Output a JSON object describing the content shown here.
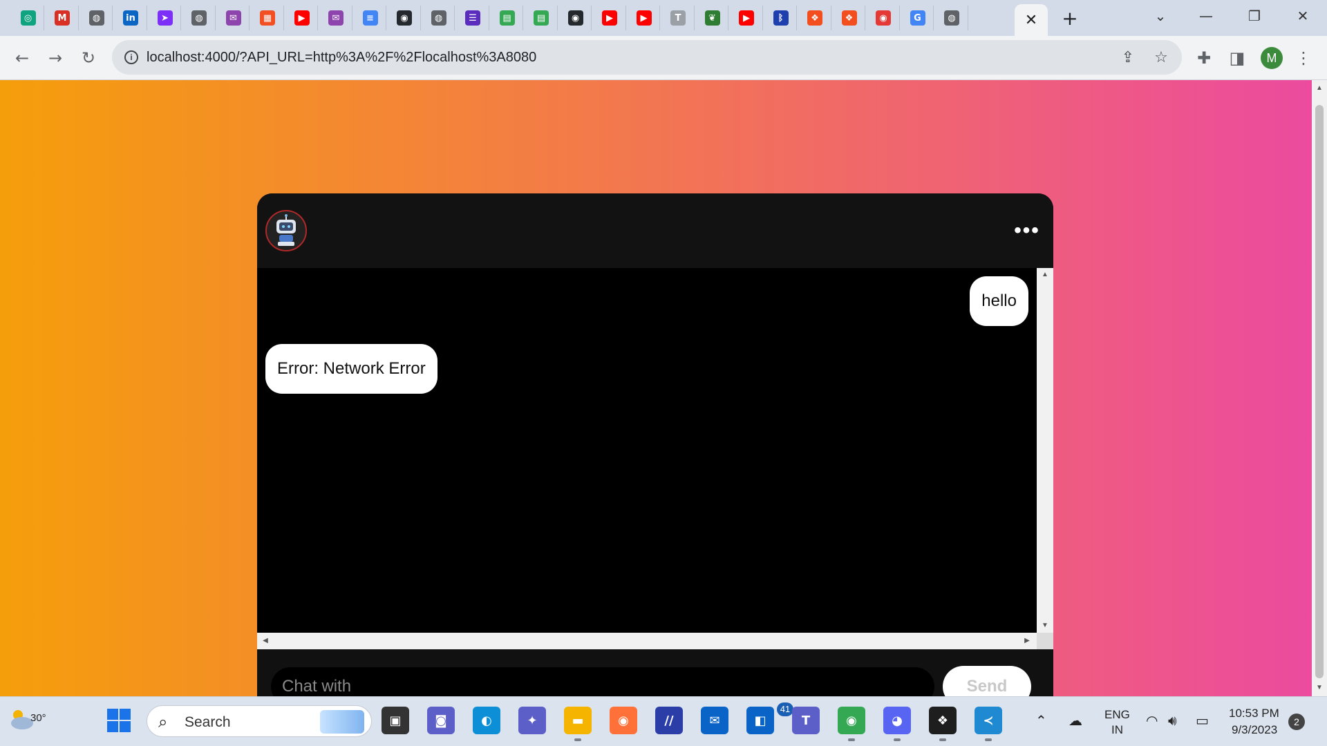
{
  "browser": {
    "tabs": [
      {
        "icon": "chatgpt-icon",
        "glyph": "◎",
        "color": "#10a37f"
      },
      {
        "icon": "gmail-icon",
        "glyph": "M",
        "color": "#d93025"
      },
      {
        "icon": "globe-icon",
        "glyph": "◍",
        "color": "#5f6368"
      },
      {
        "icon": "linkedin-icon",
        "glyph": "in",
        "color": "#0a66c2"
      },
      {
        "icon": "arrow-app-icon",
        "glyph": "➤",
        "color": "#7b2ff7"
      },
      {
        "icon": "globe-icon",
        "glyph": "◍",
        "color": "#5f6368"
      },
      {
        "icon": "mail-icon",
        "glyph": "✉",
        "color": "#8e44ad"
      },
      {
        "icon": "microsoft-icon",
        "glyph": "▦",
        "color": "#f25022"
      },
      {
        "icon": "youtube-icon",
        "glyph": "▶",
        "color": "#ff0000"
      },
      {
        "icon": "mail-icon",
        "glyph": "✉",
        "color": "#8e44ad"
      },
      {
        "icon": "docs-icon",
        "glyph": "≡",
        "color": "#4285f4"
      },
      {
        "icon": "github-icon",
        "glyph": "◉",
        "color": "#24292e"
      },
      {
        "icon": "globe-icon",
        "glyph": "◍",
        "color": "#5f6368"
      },
      {
        "icon": "list-app-icon",
        "glyph": "☰",
        "color": "#5b2dbf"
      },
      {
        "icon": "sheets-icon",
        "glyph": "▤",
        "color": "#34a853"
      },
      {
        "icon": "sheets-icon",
        "glyph": "▤",
        "color": "#34a853"
      },
      {
        "icon": "github-icon",
        "glyph": "◉",
        "color": "#24292e"
      },
      {
        "icon": "youtube-icon",
        "glyph": "▶",
        "color": "#ff0000"
      },
      {
        "icon": "youtube-icon",
        "glyph": "▶",
        "color": "#ff0000"
      },
      {
        "icon": "text-app-icon",
        "glyph": "T",
        "color": "#9aa0a6"
      },
      {
        "icon": "leaf-icon",
        "glyph": "❦",
        "color": "#2e7d32"
      },
      {
        "icon": "youtube-icon",
        "glyph": "▶",
        "color": "#ff0000"
      },
      {
        "icon": "bluetooth-icon",
        "glyph": "ᛒ",
        "color": "#1e40af"
      },
      {
        "icon": "figma-icon",
        "glyph": "❖",
        "color": "#f24e1e"
      },
      {
        "icon": "figma-icon",
        "glyph": "❖",
        "color": "#f24e1e"
      },
      {
        "icon": "screen-recorder-icon",
        "glyph": "◉",
        "color": "#e53935"
      },
      {
        "icon": "google-icon",
        "glyph": "G",
        "color": "#4285f4"
      },
      {
        "icon": "globe-icon",
        "glyph": "◍",
        "color": "#5f6368"
      }
    ],
    "active_tab_close": "✕",
    "new_tab": "+",
    "url": "localhost:4000/?API_URL=http%3A%2F%2Flocalhost%3A8080",
    "profile_initial": "M"
  },
  "chat": {
    "messages": [
      {
        "sender": "user",
        "text": "hello"
      },
      {
        "sender": "bot",
        "text": "Error: Network Error"
      }
    ],
    "input_placeholder": "Chat with",
    "input_value": "",
    "send_label": "Send",
    "menu_glyph": "•••"
  },
  "taskbar": {
    "weather_temp": "30°",
    "search_label": "Search",
    "apps": [
      {
        "name": "task-view-icon",
        "glyph": "▣",
        "color": "#333"
      },
      {
        "name": "meet-icon",
        "glyph": "◙",
        "color": "#5b5fc7"
      },
      {
        "name": "edge-icon",
        "glyph": "◐",
        "color": "#0c8fd6"
      },
      {
        "name": "copilot-icon",
        "glyph": "✦",
        "color": "#5b5fc7"
      },
      {
        "name": "file-explorer-icon",
        "glyph": "▬",
        "color": "#f4b400"
      },
      {
        "name": "firefox-icon",
        "glyph": "◉",
        "color": "#ff7139"
      },
      {
        "name": "ai-app-icon",
        "glyph": "//",
        "color": "#2b3ea8"
      },
      {
        "name": "mail-icon",
        "glyph": "✉",
        "color": "#0a64c8"
      },
      {
        "name": "outlook-icon",
        "glyph": "◧",
        "color": "#0a64c8"
      },
      {
        "name": "teams-icon",
        "glyph": "T",
        "color": "#5b5fc7"
      },
      {
        "name": "chrome-icon",
        "glyph": "◉",
        "color": "#34a853"
      },
      {
        "name": "discord-icon",
        "glyph": "◕",
        "color": "#5865f2"
      },
      {
        "name": "figma-icon",
        "glyph": "❖",
        "color": "#1e1e1e"
      },
      {
        "name": "vscode-icon",
        "glyph": "≺",
        "color": "#1f8ad2"
      }
    ],
    "outlook_badge": "41",
    "chrome_profile": "M",
    "lang_line1": "ENG",
    "lang_line2": "IN",
    "time": "10:53 PM",
    "date": "9/3/2023",
    "notification_count": "2"
  }
}
